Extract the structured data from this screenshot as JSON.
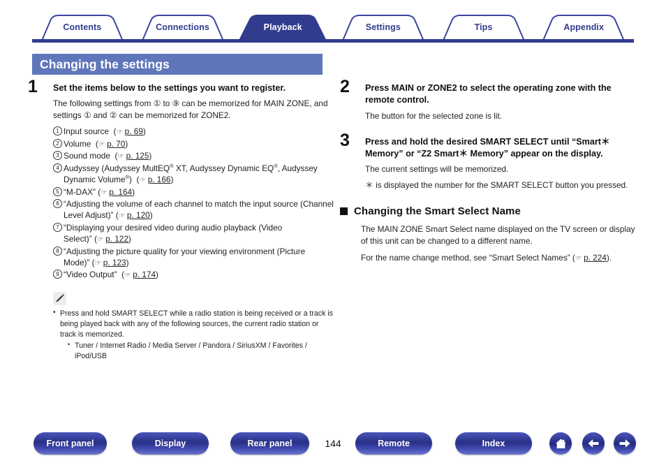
{
  "tabs": [
    {
      "label": "Contents",
      "active": false
    },
    {
      "label": "Connections",
      "active": false
    },
    {
      "label": "Playback",
      "active": true
    },
    {
      "label": "Settings",
      "active": false
    },
    {
      "label": "Tips",
      "active": false
    },
    {
      "label": "Appendix",
      "active": false
    }
  ],
  "colors": {
    "tab_border": "#3b46a0",
    "tab_active_bg": "#323c8e",
    "tab_text": "#323c8e",
    "tab_underline": "#323c8e",
    "title_bg": "#6076bb",
    "title_text": "#ffffff",
    "button_blue": "#2a2f86",
    "body_text": "#222222"
  },
  "section": {
    "title": "Changing the settings"
  },
  "steps": [
    {
      "num": "1",
      "heading": "Set the items below to the settings you want to register.",
      "paragraph": "The following settings from ① to ⑨ can be memorized for MAIN ZONE, and settings ① and ② can be memorized for ZONE2.",
      "list": [
        {
          "n": "1",
          "text": "Input source",
          "ref_prefix": "(",
          "ref_page": "p. 69",
          "ref_suffix": ")"
        },
        {
          "n": "2",
          "text": "Volume",
          "ref_prefix": "(",
          "ref_page": "p. 70",
          "ref_suffix": ")"
        },
        {
          "n": "3",
          "text": "Sound mode",
          "ref_prefix": "(",
          "ref_page": "p. 125",
          "ref_suffix": ")"
        },
        {
          "n": "4",
          "text": "Audyssey (Audyssey MultEQ® XT, Audyssey Dynamic EQ®, Audyssey Dynamic Volume®)",
          "ref_prefix": "(",
          "ref_page": "p. 166",
          "ref_suffix": ")"
        },
        {
          "n": "5",
          "text": "“M-DAX”",
          "ref_prefix": "(",
          "ref_page": "p. 164",
          "ref_suffix": ")"
        },
        {
          "n": "6",
          "text": "“Adjusting the volume of each channel to match the input source (Channel Level Adjust)”",
          "ref_prefix": "(",
          "ref_page": "p. 120",
          "ref_suffix": ")"
        },
        {
          "n": "7",
          "text": "“Displaying your desired video during audio playback (Video Select)”",
          "ref_prefix": "(",
          "ref_page": "p. 122",
          "ref_suffix": ")"
        },
        {
          "n": "8",
          "text": "“Adjusting the picture quality for your viewing environment (Picture Mode)”",
          "ref_prefix": "(",
          "ref_page": "p. 123",
          "ref_suffix": ")"
        },
        {
          "n": "9",
          "text": "“Video Output”",
          "ref_prefix": "(",
          "ref_page": "p. 174",
          "ref_suffix": ")"
        }
      ]
    },
    {
      "num": "2",
      "heading": "Press MAIN or ZONE2 to select the operating zone with the remote control.",
      "paragraph": "The button for the selected zone is lit."
    },
    {
      "num": "3",
      "heading": "Press and hold the desired SMART SELECT until “Smart＊ Memory” or “Z2 Smart＊ Memory” appear on the display.",
      "paragraph": "The current settings will be memorized.",
      "paragraph2": "＊ is displayed the number for the SMART SELECT button you pressed."
    }
  ],
  "note": {
    "icon": "pencil-icon",
    "bullets": [
      "Press and hold SMART SELECT while a radio station is being received or a track is being played back with any of the following sources, the current radio station or track is memorized."
    ],
    "subbullets": [
      "Tuner / Internet Radio / Media Server / Pandora / SiriusXM / Favorites / iPod/USB"
    ]
  },
  "subsection": {
    "heading": "Changing the Smart Select Name",
    "paragraph1": "The MAIN ZONE Smart Select name displayed on the TV screen or display of this unit can be changed to a different name.",
    "paragraph2_pre": "For the name change method, see “Smart Select Names” (",
    "paragraph2_page": "p. 224",
    "paragraph2_post": ")."
  },
  "footer": {
    "buttons": [
      {
        "label": "Front panel",
        "id": "front-panel"
      },
      {
        "label": "Display",
        "id": "display"
      },
      {
        "label": "Rear panel",
        "id": "rear-panel"
      },
      {
        "label": "Remote",
        "id": "remote"
      },
      {
        "label": "Index",
        "id": "index"
      }
    ],
    "page_number": "144",
    "icons": [
      {
        "name": "home-icon"
      },
      {
        "name": "arrow-left-icon"
      },
      {
        "name": "arrow-right-icon"
      }
    ]
  }
}
